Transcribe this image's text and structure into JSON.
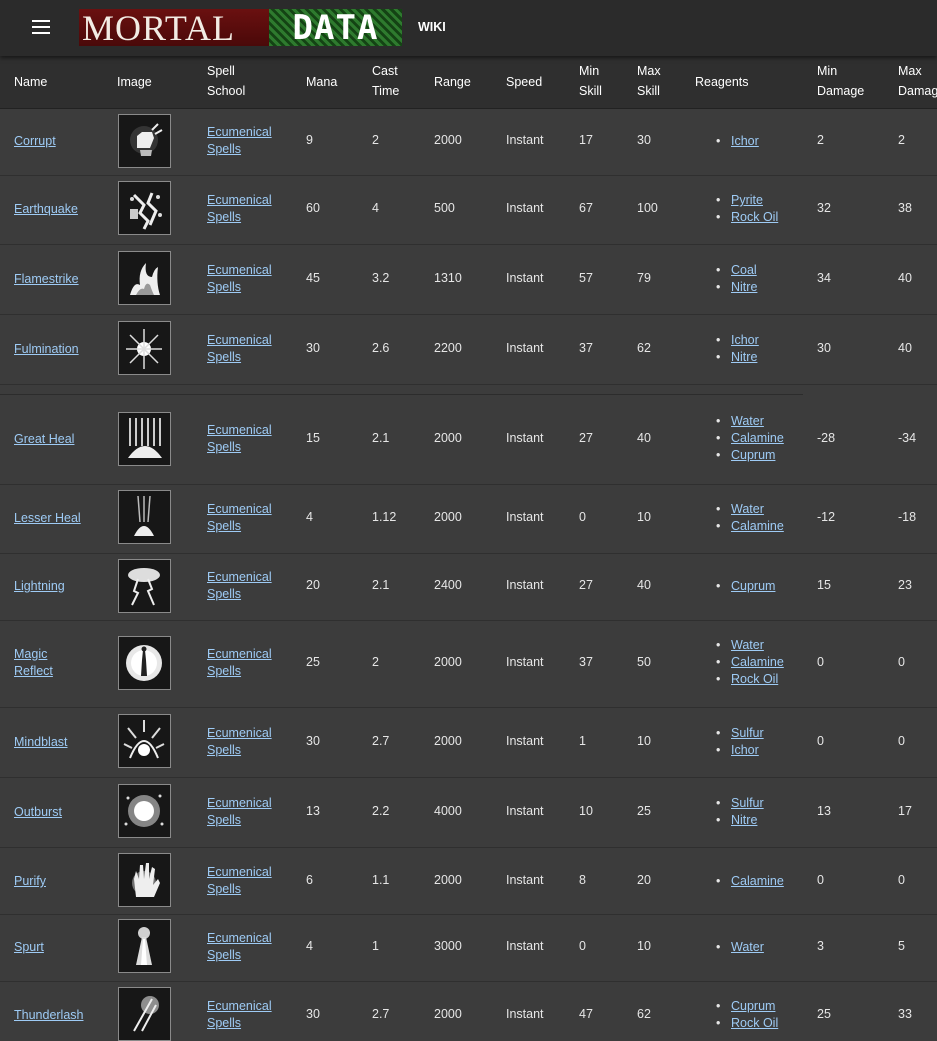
{
  "nav": {
    "logo_left": "MORTAL",
    "logo_right": "DATA",
    "wiki": "WIKI"
  },
  "columns": {
    "name": "Name",
    "image": "Image",
    "school_1": "Spell",
    "school_2": "School",
    "mana": "Mana",
    "cast_1": "Cast",
    "cast_2": "Time",
    "range": "Range",
    "speed": "Speed",
    "minskill_1": "Min",
    "minskill_2": "Skill",
    "maxskill_1": "Max",
    "maxskill_2": "Skill",
    "reagents": "Reagents",
    "mindmg_1": "Min",
    "mindmg_2": "Damage",
    "maxdmg_1": "Max",
    "maxdmg_2": "Damage"
  },
  "school_word1": "Ecumenical",
  "school_word2": "Spells",
  "spells": [
    {
      "name1": "Corrupt",
      "name2": "",
      "icon": "corrupt-fist-icon",
      "mana": "9",
      "cast": "2",
      "range": "2000",
      "speed": "Instant",
      "min_skill": "17",
      "max_skill": "30",
      "reagents": [
        "Ichor"
      ],
      "min_damage": "2",
      "max_damage": "2"
    },
    {
      "name1": "Earthquake",
      "name2": "",
      "icon": "earthquake-icon",
      "mana": "60",
      "cast": "4",
      "range": "500",
      "speed": "Instant",
      "min_skill": "67",
      "max_skill": "100",
      "reagents": [
        "Pyrite",
        "Rock Oil"
      ],
      "min_damage": "32",
      "max_damage": "38"
    },
    {
      "name1": "Flamestrike",
      "name2": "",
      "icon": "flame-icon",
      "mana": "45",
      "cast": "3.2",
      "range": "1310",
      "speed": "Instant",
      "min_skill": "57",
      "max_skill": "79",
      "reagents": [
        "Coal",
        "Nitre"
      ],
      "min_damage": "34",
      "max_damage": "40"
    },
    {
      "name1": "Fulmination",
      "name2": "",
      "icon": "burst-icon",
      "mana": "30",
      "cast": "2.6",
      "range": "2200",
      "speed": "Instant",
      "min_skill": "37",
      "max_skill": "62",
      "reagents": [
        "Ichor",
        "Nitre"
      ],
      "min_damage": "30",
      "max_damage": "40"
    },
    {
      "name1": "Great Heal",
      "name2": "",
      "icon": "heal-light-icon",
      "mana": "15",
      "cast": "2.1",
      "range": "2000",
      "speed": "Instant",
      "min_skill": "27",
      "max_skill": "40",
      "reagents": [
        "Water",
        "Calamine",
        "Cuprum"
      ],
      "min_damage": "-28",
      "max_damage": "-34"
    },
    {
      "name1": "Lesser Heal",
      "name2": "",
      "icon": "heal-light-small-icon",
      "mana": "4",
      "cast": "1.12",
      "range": "2000",
      "speed": "Instant",
      "min_skill": "0",
      "max_skill": "10",
      "reagents": [
        "Water",
        "Calamine"
      ],
      "min_damage": "-12",
      "max_damage": "-18"
    },
    {
      "name1": "Lightning",
      "name2": "",
      "icon": "lightning-cloud-icon",
      "mana": "20",
      "cast": "2.1",
      "range": "2400",
      "speed": "Instant",
      "min_skill": "27",
      "max_skill": "40",
      "reagents": [
        "Cuprum"
      ],
      "min_damage": "15",
      "max_damage": "23"
    },
    {
      "name1": "Magic",
      "name2": "Reflect",
      "icon": "reflect-figure-icon",
      "mana": "25",
      "cast": "2",
      "range": "2000",
      "speed": "Instant",
      "min_skill": "37",
      "max_skill": "50",
      "reagents": [
        "Water",
        "Calamine",
        "Rock Oil"
      ],
      "min_damage": "0",
      "max_damage": "0"
    },
    {
      "name1": "Mindblast",
      "name2": "",
      "icon": "mind-spikes-icon",
      "mana": "30",
      "cast": "2.7",
      "range": "2000",
      "speed": "Instant",
      "min_skill": "1",
      "max_skill": "10",
      "reagents": [
        "Sulfur",
        "Ichor"
      ],
      "min_damage": "0",
      "max_damage": "0"
    },
    {
      "name1": "Outburst",
      "name2": "",
      "icon": "outburst-orb-icon",
      "mana": "13",
      "cast": "2.2",
      "range": "4000",
      "speed": "Instant",
      "min_skill": "10",
      "max_skill": "25",
      "reagents": [
        "Sulfur",
        "Nitre"
      ],
      "min_damage": "13",
      "max_damage": "17"
    },
    {
      "name1": "Purify",
      "name2": "",
      "icon": "glowing-hand-icon",
      "mana": "6",
      "cast": "1.1",
      "range": "2000",
      "speed": "Instant",
      "min_skill": "8",
      "max_skill": "20",
      "reagents": [
        "Calamine"
      ],
      "min_damage": "0",
      "max_damage": "0"
    },
    {
      "name1": "Spurt",
      "name2": "",
      "icon": "spurt-fountain-icon",
      "mana": "4",
      "cast": "1",
      "range": "3000",
      "speed": "Instant",
      "min_skill": "0",
      "max_skill": "10",
      "reagents": [
        "Water"
      ],
      "min_damage": "3",
      "max_damage": "5"
    },
    {
      "name1": "Thunderlash",
      "name2": "",
      "icon": "thunder-lash-icon",
      "mana": "30",
      "cast": "2.7",
      "range": "2000",
      "speed": "Instant",
      "min_skill": "47",
      "max_skill": "62",
      "reagents": [
        "Cuprum",
        "Rock Oil"
      ],
      "min_damage": "25",
      "max_damage": "33"
    }
  ]
}
